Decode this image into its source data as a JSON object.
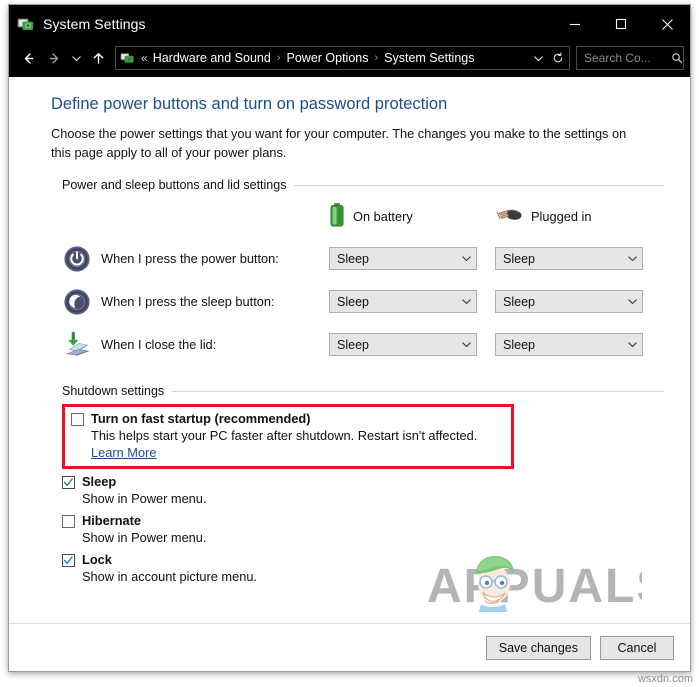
{
  "window": {
    "title": "System Settings",
    "icon": "system-settings-icon",
    "controls": {
      "minimize": "minimize-icon",
      "maximize": "maximize-icon",
      "close": "close-icon"
    }
  },
  "addressbar": {
    "back": "back-arrow-icon",
    "forward": "forward-arrow-icon",
    "recent": "chevron-down-icon",
    "up": "up-arrow-icon",
    "crumb_icon": "control-panel-icon",
    "overflow": "«",
    "breadcrumbs": [
      "Hardware and Sound",
      "Power Options",
      "System Settings"
    ],
    "separator": "›",
    "dropdown": "chevron-down-icon",
    "refresh": "refresh-icon",
    "search": {
      "placeholder": "Search Co...",
      "value": "",
      "icon": "search-icon"
    }
  },
  "page": {
    "title": "Define power buttons and turn on password protection",
    "description": "Choose the power settings that you want for your computer. The changes you make to the settings on this page apply to all of your power plans."
  },
  "power_group": {
    "header": "Power and sleep buttons and lid settings",
    "columns": [
      {
        "label": "On battery",
        "icon": "battery-icon"
      },
      {
        "label": "Plugged in",
        "icon": "power-plug-icon"
      }
    ],
    "rows": [
      {
        "icon": "power-button-icon",
        "label": "When I press the power button:",
        "on_battery": "Sleep",
        "plugged_in": "Sleep"
      },
      {
        "icon": "sleep-moon-icon",
        "label": "When I press the sleep button:",
        "on_battery": "Sleep",
        "plugged_in": "Sleep"
      },
      {
        "icon": "laptop-lid-icon",
        "label": "When I close the lid:",
        "on_battery": "Sleep",
        "plugged_in": "Sleep"
      }
    ]
  },
  "shutdown_group": {
    "header": "Shutdown settings",
    "highlight_color": "#e8112d",
    "fast_startup": {
      "label": "Turn on fast startup (recommended)",
      "checked": false,
      "description_before_link": "This helps start your PC faster after shutdown. Restart isn't affected. ",
      "link_text": "Learn More",
      "highlighted": true
    },
    "options": [
      {
        "label": "Sleep",
        "checked": true,
        "description": "Show in Power menu."
      },
      {
        "label": "Hibernate",
        "checked": false,
        "description": "Show in Power menu."
      },
      {
        "label": "Lock",
        "checked": true,
        "description": "Show in account picture menu."
      }
    ]
  },
  "footer": {
    "save_label": "Save changes",
    "cancel_label": "Cancel"
  },
  "watermark": {
    "brand": "APPUALS",
    "corner_credit": "wsxdn.com"
  }
}
